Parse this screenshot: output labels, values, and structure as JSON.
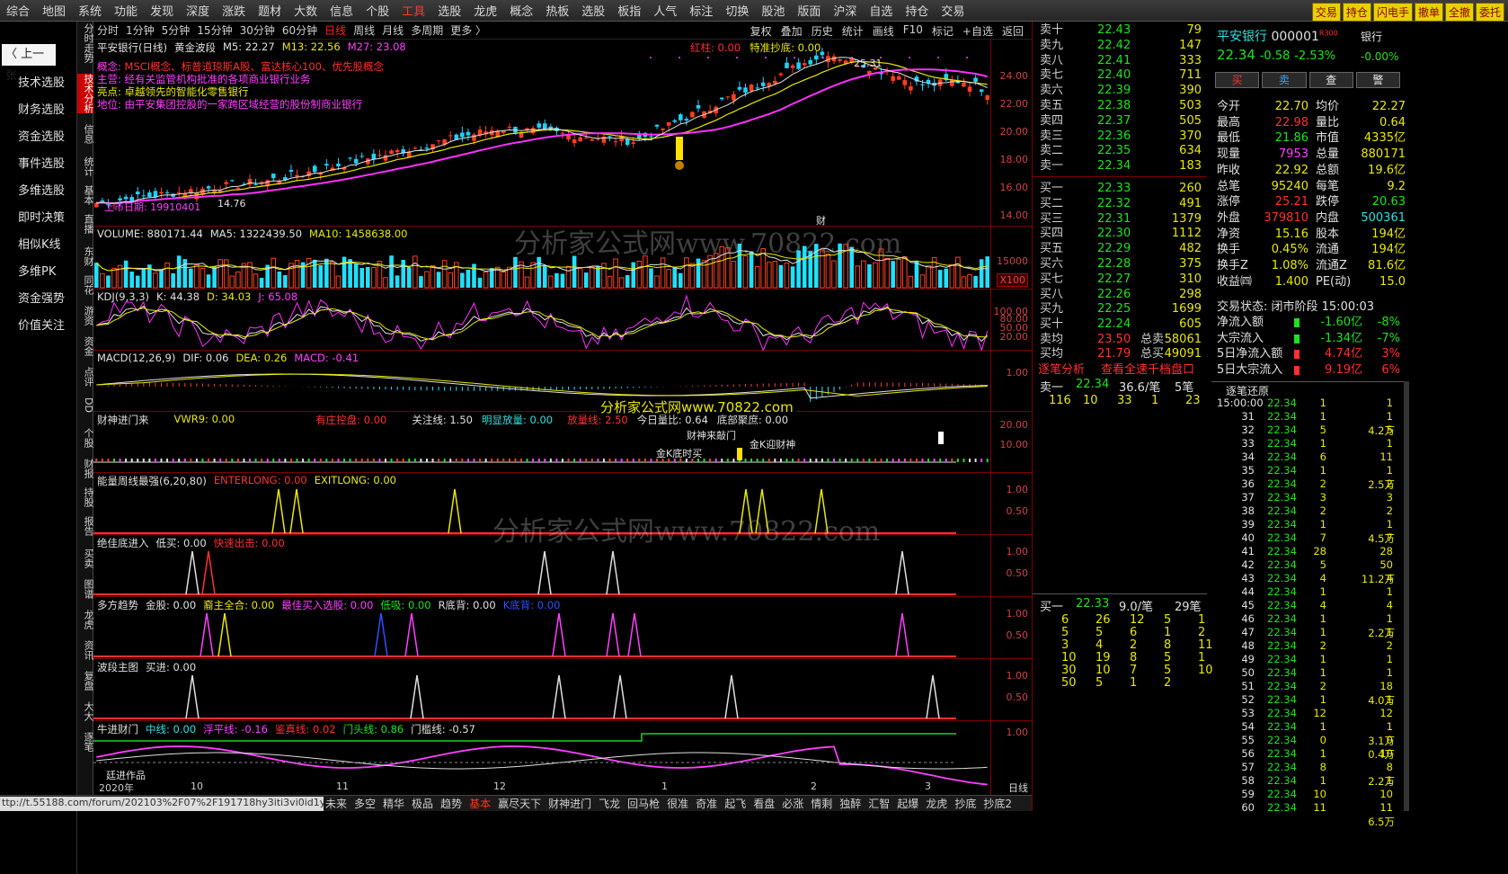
{
  "topmenu": [
    "综合",
    "地图",
    "系统",
    "功能",
    "发现",
    "深度",
    "涨跌",
    "题材",
    "大数",
    "信息",
    "个股",
    "工具",
    "选股",
    "龙虎",
    "概念",
    "热板",
    "选股",
    "板指",
    "人气",
    "标注",
    "切换",
    "股池",
    "版面",
    "沪深",
    "自选",
    "持仓",
    "交易"
  ],
  "topright": [
    "交易",
    "持仓",
    "闪电手",
    "撤单",
    "全撤",
    "委托"
  ],
  "left": {
    "prev": "上一张",
    "menu": [
      "技术选股",
      "财务选股",
      "资金选股",
      "事件选股",
      "多维选股",
      "即时决策",
      "相似K线",
      "多维PK",
      "资金强势",
      "价值关注"
    ]
  },
  "vtabs": [
    "分时走势",
    "技术分析",
    "信息",
    "统计",
    "基本",
    "直播",
    "东财",
    "同花",
    "游资",
    "资金",
    "点评",
    "DD",
    "个股",
    "财报",
    "持股",
    "报告",
    "买卖",
    "图谱",
    "龙虎",
    "资讯",
    "复盘",
    "大大",
    "逐笔"
  ],
  "periods": [
    "分时",
    "1分钟",
    "5分钟",
    "15分钟",
    "30分钟",
    "60分钟",
    "日线",
    "周线",
    "月线",
    "多周期",
    "更多 〉"
  ],
  "tools": [
    "复权",
    "叠加",
    "历史",
    "统计",
    "画线",
    "F10",
    "标记",
    "+自选",
    "返回"
  ],
  "price": {
    "title": "平安银行(日线)",
    "indicator": "黄金波段",
    "m5": "M5: 22.27",
    "m13": "M13: 22.56",
    "m27": "M27: 23.08",
    "hongzhu": "红柱: 0.00",
    "tezhun": "特准抄底: 0.00",
    "concept_l": "概念:",
    "concept": "MSCI概念、标普道琼斯A股、富达核心100、优先股概念",
    "main_l": "主营:",
    "main": "经有关监管机构批准的各项商业银行业务",
    "highlight_l": "亮点:",
    "highlight": "卓越领先的智能化零售银行",
    "position_l": "地位:",
    "position": "由平安集团控股的一家跨区域经营的股份制商业银行",
    "listed": "上市日期: 19910401",
    "low": "14.76",
    "high": "25.31",
    "axis": [
      "24.00",
      "22.00",
      "20.00",
      "18.00",
      "16.00",
      "14.00"
    ],
    "cai": "财"
  },
  "volume": {
    "t1": "VOLUME: 880171.44",
    "t2": "MA5: 1322439.50",
    "t3": "MA10: 1458638.00",
    "axis": [
      "15000"
    ],
    "x100": "X100"
  },
  "kdj": {
    "t0": "KDJ(9,3,3)",
    "t1": "K: 44.38",
    "t2": "D: 34.03",
    "t3": "J: 65.08",
    "axis": [
      "100.00",
      "80.00",
      "50.00",
      "20.00"
    ]
  },
  "macd": {
    "t0": "MACD(12,26,9)",
    "t1": "DIF: 0.06",
    "t2": "DEA: 0.26",
    "t3": "MACD: -0.41",
    "axis": [
      "1.00"
    ]
  },
  "caishen": {
    "t0": "财神进门来",
    "t1": "VWR9: 0.00",
    "t2": "有庄控盘: 0.00",
    "t3": "关注线: 1.50",
    "t4": "明显放量: 0.00",
    "t5": "放量线: 2.50",
    "t6": "今日量比: 0.64",
    "t7": "底部聚庶: 0.00",
    "l1": "财神来敲门",
    "l2": "金K迎财神",
    "l3": "金K底时买",
    "axis": [
      "20.00",
      "10.00"
    ]
  },
  "nengliang": {
    "t0": "能量周线最强(6,20,80)",
    "t1": "ENTERLONG: 0.00",
    "t2": "EXITLONG: 0.00",
    "axis": [
      "1.00",
      "0.50"
    ]
  },
  "juejia": {
    "t0": "绝佳底进入",
    "t1": "低买: 0.00",
    "t2": "快速出击: 0.00",
    "axis": [
      "1.00",
      "0.50"
    ]
  },
  "duofang": {
    "t0": "多方趋势",
    "t1": "金股: 0.00",
    "t2": "裔主全合: 0.00",
    "t3": "最佳买入选股: 0.00",
    "t4": "低吸: 0.00",
    "t5": "R底背: 0.00",
    "t6": "K底背: 0.00",
    "axis": [
      "1.00",
      "0.50"
    ]
  },
  "boduan": {
    "t0": "波段主图",
    "t1": "买进: 0.00",
    "axis": [
      "1.00",
      "0.50"
    ]
  },
  "niujin": {
    "t0": "牛进财门",
    "t1": "中线: 0.00",
    "t2": "浮平线: -0.16",
    "t3": "鉴真线: 0.02",
    "t4": "门头线: 0.86",
    "t5": "门槛线: -0.57",
    "author": "廷进作品",
    "axis": [
      "1.00"
    ],
    "dates": [
      "2020年",
      "10",
      "11",
      "12",
      "1",
      "2",
      "3"
    ],
    "rixian": "日线"
  },
  "watermark": "分析家公式网www.70822.com",
  "bottomtabs": [
    "未来",
    "多空",
    "精华",
    "极品",
    "趋势",
    "基本",
    "赢尽天下",
    "财神进门",
    "飞龙",
    "回马枪",
    "很准",
    "奇准",
    "起飞",
    "看盘",
    "必涨",
    "情剩",
    "独醉",
    "汇智",
    "起爆",
    "龙虎",
    "抄底",
    "抄底2"
  ],
  "url": "ttp://t.55188.com/forum/202103%2F07%2F191718hy3iti3vi0id1ytv.png",
  "book": {
    "sell": [
      [
        "卖十",
        "22.43",
        "79"
      ],
      [
        "卖九",
        "22.42",
        "147"
      ],
      [
        "卖八",
        "22.41",
        "333"
      ],
      [
        "卖七",
        "22.40",
        "711"
      ],
      [
        "卖六",
        "22.39",
        "390"
      ],
      [
        "卖五",
        "22.38",
        "503"
      ],
      [
        "卖四",
        "22.37",
        "505"
      ],
      [
        "卖三",
        "22.36",
        "370"
      ],
      [
        "卖二",
        "22.35",
        "634"
      ],
      [
        "卖一",
        "22.34",
        "183"
      ]
    ],
    "buy": [
      [
        "买一",
        "22.33",
        "260"
      ],
      [
        "买二",
        "22.32",
        "491"
      ],
      [
        "买三",
        "22.31",
        "1379"
      ],
      [
        "买四",
        "22.30",
        "1112"
      ],
      [
        "买五",
        "22.29",
        "482"
      ],
      [
        "买六",
        "22.28",
        "375"
      ],
      [
        "买七",
        "22.27",
        "310"
      ],
      [
        "买八",
        "22.26",
        "298"
      ],
      [
        "买九",
        "22.25",
        "1699"
      ],
      [
        "买十",
        "22.24",
        "605"
      ]
    ],
    "avg_sell_l": "卖均",
    "avg_sell": "23.50",
    "total_sell_l": "总卖",
    "total_sell": "58061",
    "avg_buy_l": "买均",
    "avg_buy": "21.79",
    "total_buy_l": "总买",
    "total_buy": "49091"
  },
  "tick": {
    "h1": "逐笔分析",
    "h2": "查看全速千档盘口",
    "s_l": "卖一",
    "s_p": "22.34",
    "s_r": "36.6/笔",
    "s_n": "5笔",
    "s_vals": [
      "116",
      "10",
      "33",
      "1",
      "23"
    ],
    "b_l": "买一",
    "b_p": "22.33",
    "b_r": "9.0/笔",
    "b_n": "29笔",
    "b_vals": [
      [
        "6",
        "26",
        "12",
        "5",
        "1"
      ],
      [
        "5",
        "5",
        "6",
        "1",
        "2"
      ],
      [
        "3",
        "4",
        "2",
        "8",
        "11"
      ],
      [
        "10",
        "19",
        "8",
        "5",
        "1"
      ],
      [
        "30",
        "10",
        "7",
        "5",
        "10"
      ],
      [
        "50",
        "5",
        "1",
        "2",
        ""
      ]
    ]
  },
  "stock": {
    "name": "平安银行",
    "code": "000001",
    "tag": "R300",
    "sector": "银行",
    "sector_chg": "-0.00%",
    "price": "22.34",
    "chg": "-0.58",
    "pct": "-2.53%",
    "btns": [
      "买",
      "卖",
      "查",
      "警"
    ],
    "rows": [
      [
        "今开",
        "22.70",
        "均价",
        "22.27"
      ],
      [
        "最高",
        "22.98",
        "量比",
        "0.64"
      ],
      [
        "最低",
        "21.86",
        "市值",
        "4335亿"
      ],
      [
        "现量",
        "7953",
        "总量",
        "880171"
      ],
      [
        "昨收",
        "22.92",
        "总额",
        "19.6亿"
      ],
      [
        "总笔",
        "95240",
        "每笔",
        "9.2"
      ],
      [
        "涨停",
        "25.21",
        "跌停",
        "20.63"
      ],
      [
        "外盘",
        "379810",
        "内盘",
        "500361"
      ],
      [
        "净资",
        "15.16",
        "股本",
        "194亿"
      ],
      [
        "换手",
        "0.45%",
        "流通",
        "194亿"
      ],
      [
        "换手Z",
        "1.08%",
        "流通Z",
        "81.6亿"
      ],
      [
        "收益㈣",
        "1.400",
        "PE(动)",
        "15.0"
      ]
    ],
    "status": "交易状态: 闭市阶段 15:00:03",
    "flows": [
      [
        "净流入额",
        "-1.60亿",
        "-8%"
      ],
      [
        "大宗流入",
        "-1.34亿",
        "-7%"
      ],
      [
        "5日净流入额",
        "4.74亿",
        "3%"
      ],
      [
        "5日大宗流入",
        "9.19亿",
        "6%"
      ]
    ]
  },
  "detail": {
    "title": "逐笔还原",
    "rows": [
      [
        "15:00:00",
        "22.34",
        "1",
        "1"
      ],
      [
        "31",
        "22.34",
        "1",
        "1"
      ],
      [
        "32",
        "22.34",
        "5",
        "5"
      ],
      [
        "33",
        "22.34",
        "1",
        "1"
      ],
      [
        "34",
        "22.34",
        "6",
        "11"
      ],
      [
        "35",
        "22.34",
        "1",
        "1"
      ],
      [
        "36",
        "22.34",
        "2",
        "2"
      ],
      [
        "37",
        "22.34",
        "3",
        "3"
      ],
      [
        "38",
        "22.34",
        "2",
        "2"
      ],
      [
        "39",
        "22.34",
        "1",
        "1"
      ],
      [
        "40",
        "22.34",
        "7",
        "7"
      ],
      [
        "41",
        "22.34",
        "28",
        "28"
      ],
      [
        "42",
        "22.34",
        "5",
        "50"
      ],
      [
        "43",
        "22.34",
        "4",
        "4"
      ],
      [
        "44",
        "22.34",
        "1",
        "1"
      ],
      [
        "45",
        "22.34",
        "4",
        "4"
      ],
      [
        "46",
        "22.34",
        "1",
        "1"
      ],
      [
        "47",
        "22.34",
        "1",
        "1"
      ],
      [
        "48",
        "22.34",
        "2",
        "2"
      ],
      [
        "49",
        "22.34",
        "1",
        "1"
      ],
      [
        "50",
        "22.34",
        "1",
        "1"
      ],
      [
        "51",
        "22.34",
        "2",
        "18"
      ],
      [
        "52",
        "22.34",
        "1",
        "1"
      ],
      [
        "53",
        "22.34",
        "12",
        "12"
      ],
      [
        "54",
        "22.34",
        "1",
        "1"
      ],
      [
        "55",
        "22.34",
        "0",
        "0"
      ],
      [
        "56",
        "22.34",
        "1",
        "10"
      ],
      [
        "57",
        "22.34",
        "8",
        "8"
      ],
      [
        "58",
        "22.34",
        "1",
        "1"
      ],
      [
        "59",
        "22.34",
        "10",
        "10"
      ],
      [
        "60",
        "22.34",
        "11",
        "11"
      ]
    ],
    "sides": [
      [
        "4.2万",
        2
      ],
      [
        "2.5万",
        6
      ],
      [
        "4.5万",
        10
      ],
      [
        "11.2万",
        13
      ],
      [
        "2.2万",
        17
      ],
      [
        "4.0万",
        22
      ],
      [
        "3.1万",
        25
      ],
      [
        "0.4万",
        26
      ],
      [
        "2.2万",
        28
      ],
      [
        "6.5万",
        31
      ]
    ]
  }
}
